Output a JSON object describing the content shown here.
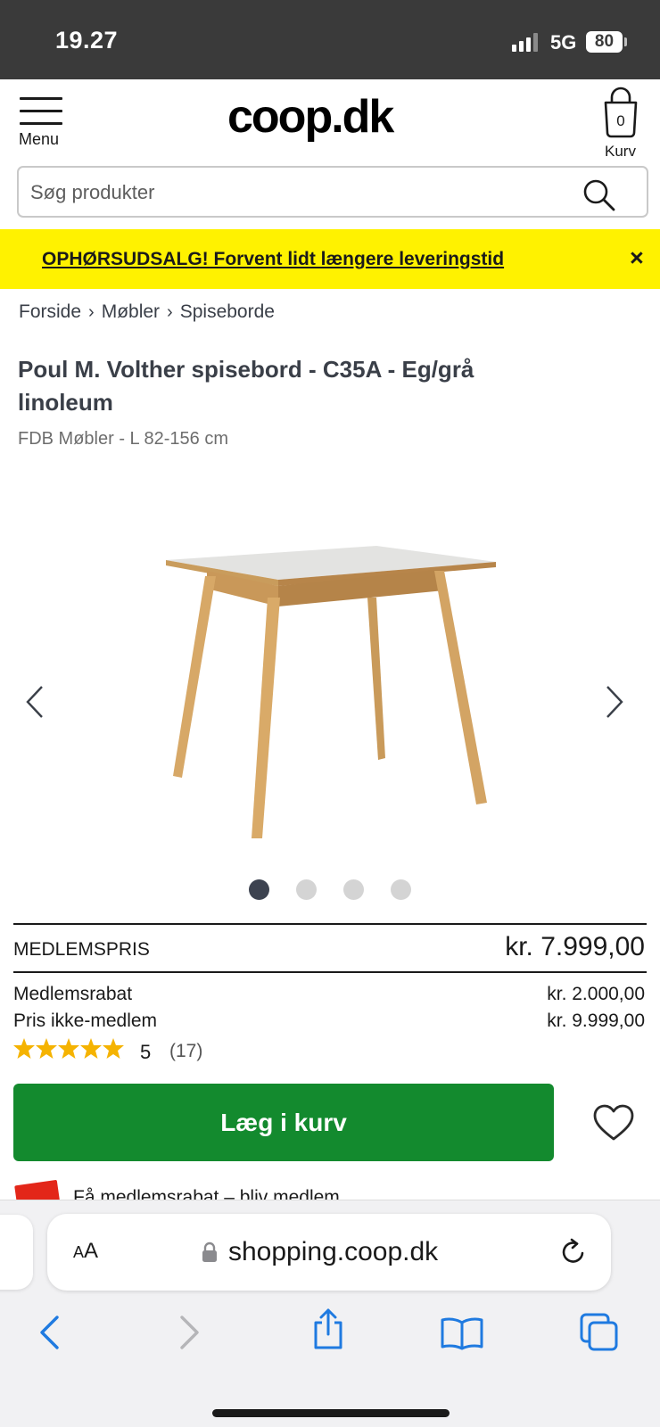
{
  "status_bar": {
    "time": "19.27",
    "network": "5G",
    "battery": "80"
  },
  "header": {
    "menu_label": "Menu",
    "logo": "coop.dk",
    "cart_label": "Kurv",
    "cart_count": "0"
  },
  "search": {
    "placeholder": "Søg produkter"
  },
  "promo": {
    "text": "OPHØRSUDSALG! Forvent lidt længere leveringstid",
    "close": "×",
    "background": "#fff200"
  },
  "breadcrumb": {
    "items": [
      "Forside",
      "Møbler",
      "Spiseborde"
    ],
    "separator": "›"
  },
  "product": {
    "title": "Poul M. Volther spisebord - C35A - Eg/grå linoleum",
    "subtitle": "FDB Møbler - L 82-156 cm",
    "gallery": {
      "image_count": 4,
      "active_index": 0,
      "image_icon": "dining-table"
    }
  },
  "pricing": {
    "member_label": "MEDLEMSPRIS",
    "member_price": "kr. 7.999,00",
    "discount_label": "Medlemsrabat",
    "discount_value": "kr. 2.000,00",
    "nonmember_label": "Pris ikke-medlem",
    "nonmember_value": "kr. 9.999,00"
  },
  "rating": {
    "stars": 5,
    "value": "5",
    "count": "(17)",
    "star_color": "#f5b301"
  },
  "actions": {
    "add_to_cart": "Læg i kurv",
    "button_color": "#138a2e"
  },
  "member_promo": {
    "text": "Få medlemsrabat – bliv medlem"
  },
  "browser": {
    "text_size_label": "AA",
    "url": "shopping.coop.dk",
    "accent": "#1f7ae0"
  }
}
